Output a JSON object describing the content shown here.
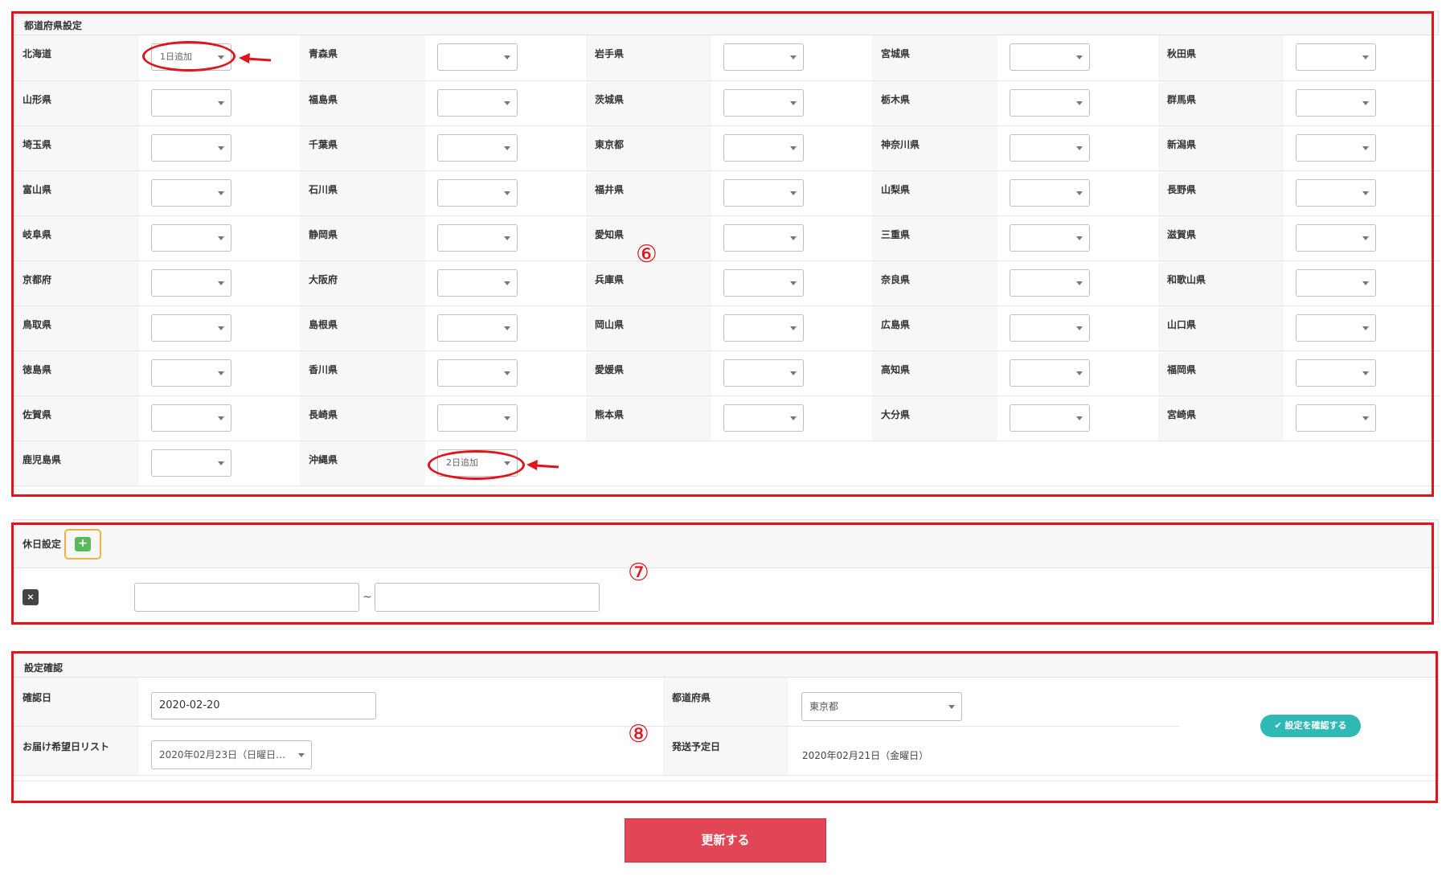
{
  "prefecture_section": {
    "title": "都道府県設定",
    "rows": [
      [
        {
          "name": "北海道",
          "value": "1日追加"
        },
        {
          "name": "青森県",
          "value": ""
        },
        {
          "name": "岩手県",
          "value": ""
        },
        {
          "name": "宮城県",
          "value": ""
        },
        {
          "name": "秋田県",
          "value": ""
        }
      ],
      [
        {
          "name": "山形県",
          "value": ""
        },
        {
          "name": "福島県",
          "value": ""
        },
        {
          "name": "茨城県",
          "value": ""
        },
        {
          "name": "栃木県",
          "value": ""
        },
        {
          "name": "群馬県",
          "value": ""
        }
      ],
      [
        {
          "name": "埼玉県",
          "value": ""
        },
        {
          "name": "千葉県",
          "value": ""
        },
        {
          "name": "東京都",
          "value": ""
        },
        {
          "name": "神奈川県",
          "value": ""
        },
        {
          "name": "新潟県",
          "value": ""
        }
      ],
      [
        {
          "name": "富山県",
          "value": ""
        },
        {
          "name": "石川県",
          "value": ""
        },
        {
          "name": "福井県",
          "value": ""
        },
        {
          "name": "山梨県",
          "value": ""
        },
        {
          "name": "長野県",
          "value": ""
        }
      ],
      [
        {
          "name": "岐阜県",
          "value": ""
        },
        {
          "name": "静岡県",
          "value": ""
        },
        {
          "name": "愛知県",
          "value": ""
        },
        {
          "name": "三重県",
          "value": ""
        },
        {
          "name": "滋賀県",
          "value": ""
        }
      ],
      [
        {
          "name": "京都府",
          "value": ""
        },
        {
          "name": "大阪府",
          "value": ""
        },
        {
          "name": "兵庫県",
          "value": ""
        },
        {
          "name": "奈良県",
          "value": ""
        },
        {
          "name": "和歌山県",
          "value": ""
        }
      ],
      [
        {
          "name": "鳥取県",
          "value": ""
        },
        {
          "name": "島根県",
          "value": ""
        },
        {
          "name": "岡山県",
          "value": ""
        },
        {
          "name": "広島県",
          "value": ""
        },
        {
          "name": "山口県",
          "value": ""
        }
      ],
      [
        {
          "name": "徳島県",
          "value": ""
        },
        {
          "name": "香川県",
          "value": ""
        },
        {
          "name": "愛媛県",
          "value": ""
        },
        {
          "name": "高知県",
          "value": ""
        },
        {
          "name": "福岡県",
          "value": ""
        }
      ],
      [
        {
          "name": "佐賀県",
          "value": ""
        },
        {
          "name": "長崎県",
          "value": ""
        },
        {
          "name": "熊本県",
          "value": ""
        },
        {
          "name": "大分県",
          "value": ""
        },
        {
          "name": "宮崎県",
          "value": ""
        }
      ],
      [
        {
          "name": "鹿児島県",
          "value": ""
        },
        {
          "name": "沖縄県",
          "value": "2日追加"
        }
      ]
    ]
  },
  "holiday_section": {
    "title": "休日設定",
    "add_icon": "+",
    "remove_icon": "×",
    "range_separator": "~",
    "start_value": "",
    "end_value": ""
  },
  "confirm_section": {
    "title": "設定確認",
    "check_date_label": "確認日",
    "check_date_value": "2020-02-20",
    "prefecture_label": "都道府県",
    "prefecture_value": "東京都",
    "desired_date_label": "お届け希望日リスト",
    "desired_date_value": "2020年02月23日（日曜日…",
    "ship_date_label": "発送予定日",
    "ship_date_value": "2020年02月21日（金曜日）",
    "check_button_label": "✔ 設定を確認する"
  },
  "update_button_label": "更新する",
  "annotations": {
    "marker_6": "⑥",
    "marker_7": "⑦",
    "marker_8": "⑧",
    "highlight_color": "#e0141d"
  }
}
